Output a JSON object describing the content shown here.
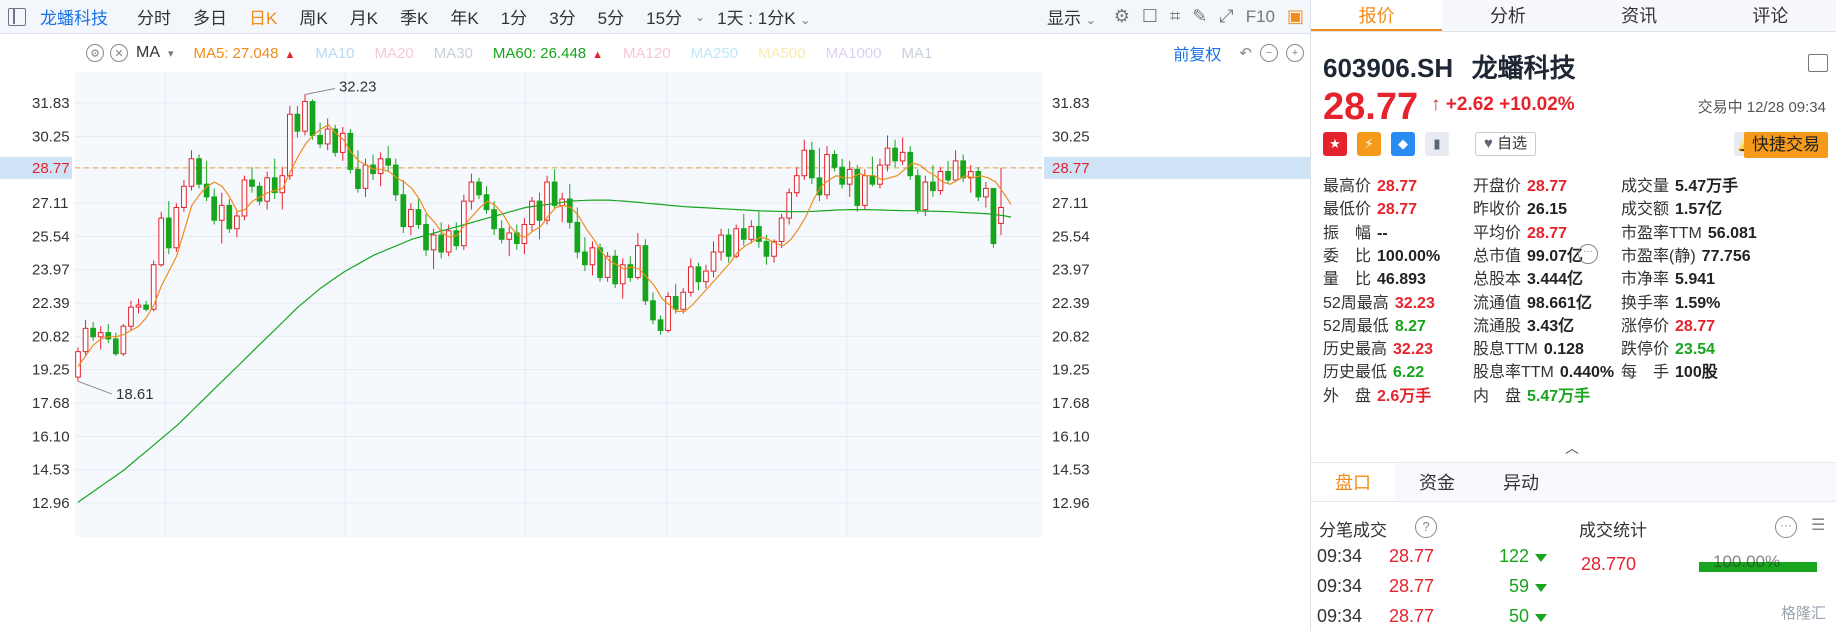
{
  "toolbar": {
    "stock_name": "龙蟠科技",
    "timeframes": [
      "分时",
      "多日",
      "日K",
      "周K",
      "月K",
      "季K",
      "年K",
      "1分",
      "3分",
      "5分",
      "15分"
    ],
    "active_timeframe": "日K",
    "period_select": "1天 : 1分K",
    "display_label": "显示"
  },
  "ma_row": {
    "indicator": "MA",
    "items": [
      {
        "label": "MA5:",
        "value": "27.048",
        "color": "#f08c1a",
        "up": true
      },
      {
        "label": "MA10",
        "value": "",
        "color": "#b8d8f5",
        "up": false
      },
      {
        "label": "MA20",
        "value": "",
        "color": "#f5c8d5",
        "up": false
      },
      {
        "label": "MA30",
        "value": "",
        "color": "#c8d0dc",
        "up": false
      },
      {
        "label": "MA60:",
        "value": "26.448",
        "color": "#16a51c",
        "up": true
      },
      {
        "label": "MA120",
        "value": "",
        "color": "#f5c8d5",
        "up": false
      },
      {
        "label": "MA250",
        "value": "",
        "color": "#bde8f5",
        "up": false
      },
      {
        "label": "MA500",
        "value": "",
        "color": "#f5eab5",
        "up": false
      },
      {
        "label": "MA1000",
        "value": "",
        "color": "#dcd0f0",
        "up": false
      },
      {
        "label": "MA1",
        "value": "",
        "color": "#c8d0dc",
        "up": false
      }
    ],
    "restore_label": "前复权"
  },
  "chart_data": {
    "type": "candlestick",
    "y_ticks": [
      "31.83",
      "30.25",
      "28.77",
      "27.11",
      "25.54",
      "23.97",
      "22.39",
      "20.82",
      "19.25",
      "17.68",
      "16.10",
      "14.53",
      "12.96"
    ],
    "current_price": 28.77,
    "current_price_label": "28.77",
    "high_label": "32.23",
    "low_label": "18.61",
    "ylim": [
      12.0,
      33.0
    ],
    "candles": [
      {
        "o": 18.9,
        "h": 20.3,
        "l": 18.7,
        "c": 20.1
      },
      {
        "o": 20.1,
        "h": 21.6,
        "l": 19.9,
        "c": 21.2
      },
      {
        "o": 21.2,
        "h": 21.5,
        "l": 20.6,
        "c": 20.8
      },
      {
        "o": 20.8,
        "h": 21.3,
        "l": 20.2,
        "c": 21.0
      },
      {
        "o": 21.0,
        "h": 21.4,
        "l": 20.5,
        "c": 20.7
      },
      {
        "o": 20.7,
        "h": 21.0,
        "l": 19.9,
        "c": 20.0
      },
      {
        "o": 20.0,
        "h": 21.4,
        "l": 19.9,
        "c": 21.3
      },
      {
        "o": 21.3,
        "h": 22.5,
        "l": 21.1,
        "c": 22.2
      },
      {
        "o": 22.2,
        "h": 22.6,
        "l": 21.9,
        "c": 22.3
      },
      {
        "o": 22.3,
        "h": 22.5,
        "l": 22.0,
        "c": 22.1
      },
      {
        "o": 22.1,
        "h": 24.4,
        "l": 22.0,
        "c": 24.2
      },
      {
        "o": 24.2,
        "h": 26.7,
        "l": 24.1,
        "c": 26.4
      },
      {
        "o": 26.4,
        "h": 27.2,
        "l": 24.7,
        "c": 25.0
      },
      {
        "o": 25.0,
        "h": 27.1,
        "l": 24.8,
        "c": 26.9
      },
      {
        "o": 26.9,
        "h": 28.2,
        "l": 26.7,
        "c": 27.9
      },
      {
        "o": 27.9,
        "h": 29.6,
        "l": 27.7,
        "c": 29.2
      },
      {
        "o": 29.2,
        "h": 29.4,
        "l": 27.8,
        "c": 28.0
      },
      {
        "o": 28.0,
        "h": 29.1,
        "l": 27.2,
        "c": 27.4
      },
      {
        "o": 27.4,
        "h": 27.8,
        "l": 26.1,
        "c": 26.3
      },
      {
        "o": 26.3,
        "h": 27.6,
        "l": 25.2,
        "c": 27.0
      },
      {
        "o": 27.0,
        "h": 27.3,
        "l": 25.7,
        "c": 25.9
      },
      {
        "o": 25.9,
        "h": 26.7,
        "l": 25.5,
        "c": 26.5
      },
      {
        "o": 26.5,
        "h": 28.4,
        "l": 26.3,
        "c": 28.2
      },
      {
        "o": 28.2,
        "h": 28.8,
        "l": 27.6,
        "c": 27.9
      },
      {
        "o": 27.9,
        "h": 28.1,
        "l": 27.0,
        "c": 27.2
      },
      {
        "o": 27.2,
        "h": 28.6,
        "l": 26.8,
        "c": 28.3
      },
      {
        "o": 28.3,
        "h": 29.2,
        "l": 27.3,
        "c": 27.6
      },
      {
        "o": 27.6,
        "h": 28.8,
        "l": 26.8,
        "c": 28.4
      },
      {
        "o": 28.4,
        "h": 31.7,
        "l": 28.2,
        "c": 31.3
      },
      {
        "o": 31.3,
        "h": 31.7,
        "l": 30.2,
        "c": 30.5
      },
      {
        "o": 30.5,
        "h": 32.23,
        "l": 30.3,
        "c": 31.9
      },
      {
        "o": 31.9,
        "h": 32.0,
        "l": 30.1,
        "c": 30.3
      },
      {
        "o": 30.3,
        "h": 30.9,
        "l": 29.7,
        "c": 29.9
      },
      {
        "o": 29.9,
        "h": 31.1,
        "l": 29.6,
        "c": 30.6
      },
      {
        "o": 30.6,
        "h": 30.8,
        "l": 29.3,
        "c": 29.5
      },
      {
        "o": 29.5,
        "h": 30.7,
        "l": 29.1,
        "c": 30.4
      },
      {
        "o": 30.4,
        "h": 30.6,
        "l": 28.5,
        "c": 28.7
      },
      {
        "o": 28.7,
        "h": 29.6,
        "l": 27.6,
        "c": 27.8
      },
      {
        "o": 27.8,
        "h": 29.2,
        "l": 27.4,
        "c": 28.9
      },
      {
        "o": 28.9,
        "h": 29.4,
        "l": 28.2,
        "c": 28.5
      },
      {
        "o": 28.5,
        "h": 29.5,
        "l": 27.9,
        "c": 29.2
      },
      {
        "o": 29.2,
        "h": 29.8,
        "l": 28.6,
        "c": 28.9
      },
      {
        "o": 28.9,
        "h": 29.2,
        "l": 27.2,
        "c": 27.5
      },
      {
        "o": 27.5,
        "h": 28.2,
        "l": 25.7,
        "c": 26.0
      },
      {
        "o": 26.0,
        "h": 27.1,
        "l": 25.6,
        "c": 26.8
      },
      {
        "o": 26.8,
        "h": 27.3,
        "l": 25.9,
        "c": 26.1
      },
      {
        "o": 26.1,
        "h": 26.6,
        "l": 24.6,
        "c": 24.9
      },
      {
        "o": 24.9,
        "h": 25.9,
        "l": 24.0,
        "c": 25.6
      },
      {
        "o": 25.6,
        "h": 26.2,
        "l": 24.5,
        "c": 24.8
      },
      {
        "o": 24.8,
        "h": 26.1,
        "l": 24.6,
        "c": 25.8
      },
      {
        "o": 25.8,
        "h": 26.2,
        "l": 24.9,
        "c": 25.1
      },
      {
        "o": 25.1,
        "h": 27.5,
        "l": 24.9,
        "c": 27.2
      },
      {
        "o": 27.2,
        "h": 28.5,
        "l": 26.8,
        "c": 28.1
      },
      {
        "o": 28.1,
        "h": 28.3,
        "l": 27.3,
        "c": 27.5
      },
      {
        "o": 27.5,
        "h": 27.9,
        "l": 26.6,
        "c": 26.8
      },
      {
        "o": 26.8,
        "h": 27.2,
        "l": 25.6,
        "c": 25.9
      },
      {
        "o": 25.9,
        "h": 26.3,
        "l": 25.2,
        "c": 25.4
      },
      {
        "o": 25.4,
        "h": 26.0,
        "l": 24.6,
        "c": 25.7
      },
      {
        "o": 25.7,
        "h": 26.1,
        "l": 24.9,
        "c": 25.2
      },
      {
        "o": 25.2,
        "h": 26.4,
        "l": 24.7,
        "c": 26.1
      },
      {
        "o": 26.1,
        "h": 27.4,
        "l": 25.8,
        "c": 27.2
      },
      {
        "o": 27.2,
        "h": 27.6,
        "l": 25.4,
        "c": 26.3
      },
      {
        "o": 26.3,
        "h": 28.4,
        "l": 26.1,
        "c": 28.1
      },
      {
        "o": 28.1,
        "h": 28.7,
        "l": 26.8,
        "c": 27.0
      },
      {
        "o": 27.0,
        "h": 27.6,
        "l": 26.2,
        "c": 27.3
      },
      {
        "o": 27.3,
        "h": 28.0,
        "l": 25.9,
        "c": 26.2
      },
      {
        "o": 26.2,
        "h": 26.9,
        "l": 24.5,
        "c": 24.8
      },
      {
        "o": 24.8,
        "h": 25.5,
        "l": 23.9,
        "c": 24.2
      },
      {
        "o": 24.2,
        "h": 25.3,
        "l": 23.7,
        "c": 25.0
      },
      {
        "o": 25.0,
        "h": 25.2,
        "l": 23.4,
        "c": 23.6
      },
      {
        "o": 23.6,
        "h": 24.8,
        "l": 23.4,
        "c": 24.6
      },
      {
        "o": 24.6,
        "h": 24.9,
        "l": 23.1,
        "c": 23.3
      },
      {
        "o": 23.3,
        "h": 24.5,
        "l": 22.6,
        "c": 24.2
      },
      {
        "o": 24.2,
        "h": 24.6,
        "l": 23.4,
        "c": 23.6
      },
      {
        "o": 23.6,
        "h": 25.7,
        "l": 23.5,
        "c": 25.1
      },
      {
        "o": 25.1,
        "h": 25.4,
        "l": 22.3,
        "c": 22.5
      },
      {
        "o": 22.5,
        "h": 22.9,
        "l": 21.4,
        "c": 21.6
      },
      {
        "o": 21.6,
        "h": 21.8,
        "l": 20.9,
        "c": 21.1
      },
      {
        "o": 21.1,
        "h": 22.9,
        "l": 21.0,
        "c": 22.7
      },
      {
        "o": 22.7,
        "h": 23.3,
        "l": 21.9,
        "c": 22.1
      },
      {
        "o": 22.1,
        "h": 23.1,
        "l": 21.9,
        "c": 22.9
      },
      {
        "o": 22.9,
        "h": 24.5,
        "l": 22.7,
        "c": 24.1
      },
      {
        "o": 24.1,
        "h": 24.3,
        "l": 23.0,
        "c": 23.4
      },
      {
        "o": 23.4,
        "h": 24.2,
        "l": 23.1,
        "c": 23.9
      },
      {
        "o": 23.9,
        "h": 25.3,
        "l": 23.6,
        "c": 24.8
      },
      {
        "o": 24.8,
        "h": 25.9,
        "l": 24.4,
        "c": 25.6
      },
      {
        "o": 25.6,
        "h": 25.9,
        "l": 24.3,
        "c": 24.6
      },
      {
        "o": 24.6,
        "h": 26.1,
        "l": 24.5,
        "c": 25.9
      },
      {
        "o": 25.9,
        "h": 26.6,
        "l": 25.1,
        "c": 25.4
      },
      {
        "o": 25.4,
        "h": 26.3,
        "l": 25.2,
        "c": 26.0
      },
      {
        "o": 26.0,
        "h": 26.7,
        "l": 25.0,
        "c": 25.3
      },
      {
        "o": 25.3,
        "h": 25.6,
        "l": 24.2,
        "c": 24.6
      },
      {
        "o": 24.6,
        "h": 25.4,
        "l": 24.3,
        "c": 25.3
      },
      {
        "o": 25.3,
        "h": 26.6,
        "l": 25.0,
        "c": 26.4
      },
      {
        "o": 26.4,
        "h": 27.8,
        "l": 26.1,
        "c": 27.6
      },
      {
        "o": 27.6,
        "h": 28.8,
        "l": 27.4,
        "c": 28.4
      },
      {
        "o": 28.4,
        "h": 30.1,
        "l": 28.2,
        "c": 29.6
      },
      {
        "o": 29.6,
        "h": 30.0,
        "l": 28.0,
        "c": 28.3
      },
      {
        "o": 28.3,
        "h": 29.7,
        "l": 27.2,
        "c": 27.5
      },
      {
        "o": 27.5,
        "h": 29.8,
        "l": 27.3,
        "c": 29.4
      },
      {
        "o": 29.4,
        "h": 29.6,
        "l": 28.6,
        "c": 28.8
      },
      {
        "o": 28.8,
        "h": 29.2,
        "l": 27.8,
        "c": 28.0
      },
      {
        "o": 28.0,
        "h": 29.1,
        "l": 27.4,
        "c": 28.7
      },
      {
        "o": 28.7,
        "h": 28.9,
        "l": 26.7,
        "c": 27.0
      },
      {
        "o": 27.0,
        "h": 28.7,
        "l": 26.8,
        "c": 28.4
      },
      {
        "o": 28.4,
        "h": 29.3,
        "l": 27.9,
        "c": 28.0
      },
      {
        "o": 28.0,
        "h": 29.2,
        "l": 27.8,
        "c": 28.9
      },
      {
        "o": 28.9,
        "h": 30.3,
        "l": 28.6,
        "c": 29.7
      },
      {
        "o": 29.7,
        "h": 30.1,
        "l": 28.8,
        "c": 29.1
      },
      {
        "o": 29.1,
        "h": 30.2,
        "l": 28.9,
        "c": 29.5
      },
      {
        "o": 29.5,
        "h": 29.8,
        "l": 28.2,
        "c": 28.4
      },
      {
        "o": 28.4,
        "h": 28.7,
        "l": 26.6,
        "c": 26.8
      },
      {
        "o": 26.8,
        "h": 28.4,
        "l": 26.5,
        "c": 28.1
      },
      {
        "o": 28.1,
        "h": 28.9,
        "l": 27.4,
        "c": 27.7
      },
      {
        "o": 27.7,
        "h": 28.8,
        "l": 27.5,
        "c": 28.6
      },
      {
        "o": 28.6,
        "h": 29.1,
        "l": 28.0,
        "c": 28.2
      },
      {
        "o": 28.2,
        "h": 29.6,
        "l": 28.1,
        "c": 29.1
      },
      {
        "o": 29.1,
        "h": 29.4,
        "l": 28.1,
        "c": 28.3
      },
      {
        "o": 28.3,
        "h": 28.9,
        "l": 27.6,
        "c": 28.6
      },
      {
        "o": 28.6,
        "h": 28.8,
        "l": 27.2,
        "c": 27.4
      },
      {
        "o": 27.4,
        "h": 28.1,
        "l": 26.9,
        "c": 27.8
      },
      {
        "o": 27.8,
        "h": 27.8,
        "l": 25.0,
        "c": 25.2
      },
      {
        "o": 26.15,
        "h": 28.77,
        "l": 25.6,
        "c": 26.9
      }
    ],
    "ma5": [
      19.4,
      19.9,
      20.4,
      20.7,
      20.8,
      20.8,
      20.9,
      21.1,
      21.3,
      21.7,
      22.3,
      23.2,
      23.9,
      24.6,
      25.8,
      27.0,
      27.5,
      27.9,
      28.1,
      27.9,
      27.4,
      26.7,
      26.8,
      27.2,
      27.4,
      27.6,
      27.7,
      27.8,
      28.6,
      29.3,
      29.9,
      30.3,
      30.6,
      30.8,
      30.4,
      30.1,
      29.5,
      29.1,
      28.9,
      28.7,
      28.7,
      28.6,
      28.3,
      28.1,
      27.8,
      27.3,
      26.6,
      26.2,
      25.7,
      25.5,
      25.6,
      26.1,
      26.5,
      26.9,
      27.2,
      27.0,
      26.6,
      26.0,
      25.6,
      25.5,
      25.8,
      26.0,
      26.5,
      26.9,
      27.0,
      26.9,
      26.5,
      25.9,
      25.4,
      24.8,
      24.4,
      24.2,
      24.0,
      24.1,
      24.0,
      23.6,
      23.2,
      22.6,
      22.3,
      22.0,
      22.0,
      22.3,
      22.7,
      23.1,
      23.5,
      23.9,
      24.3,
      24.8,
      25.1,
      25.3,
      25.5,
      25.4,
      25.2,
      25.1,
      25.4,
      25.9,
      26.5,
      27.3,
      27.9,
      28.2,
      28.4,
      28.3,
      28.3,
      28.5,
      28.4,
      28.4,
      28.2,
      28.3,
      28.4,
      28.7,
      29.0,
      28.9,
      28.6,
      28.4,
      28.1,
      28.0,
      28.2,
      28.4,
      28.3,
      28.4,
      28.3,
      28.1,
      27.6,
      27.048
    ],
    "ma60": [
      13.0,
      13.25,
      13.5,
      13.75,
      14.0,
      14.25,
      14.5,
      14.8,
      15.1,
      15.4,
      15.7,
      16.0,
      16.3,
      16.6,
      16.95,
      17.3,
      17.65,
      18.0,
      18.35,
      18.7,
      19.05,
      19.4,
      19.75,
      20.1,
      20.45,
      20.8,
      21.15,
      21.5,
      21.85,
      22.2,
      22.5,
      22.8,
      23.1,
      23.35,
      23.6,
      23.85,
      24.05,
      24.25,
      24.45,
      24.65,
      24.8,
      24.95,
      25.1,
      25.25,
      25.4,
      25.5,
      25.6,
      25.7,
      25.8,
      25.9,
      26.0,
      26.1,
      26.2,
      26.3,
      26.4,
      26.5,
      26.6,
      26.7,
      26.8,
      26.9,
      26.95,
      27.0,
      27.05,
      27.1,
      27.15,
      27.2,
      27.22,
      27.24,
      27.25,
      27.25,
      27.25,
      27.22,
      27.2,
      27.17,
      27.14,
      27.1,
      27.07,
      27.04,
      27.0,
      26.97,
      26.94,
      26.92,
      26.9,
      26.88,
      26.86,
      26.84,
      26.82,
      26.8,
      26.78,
      26.76,
      26.74,
      26.73,
      26.72,
      26.71,
      26.7,
      26.7,
      26.7,
      26.72,
      26.74,
      26.76,
      26.78,
      26.79,
      26.8,
      26.8,
      26.8,
      26.79,
      26.78,
      26.77,
      26.76,
      26.75,
      26.75,
      26.74,
      26.73,
      26.72,
      26.71,
      26.7,
      26.68,
      26.66,
      26.64,
      26.62,
      26.6,
      26.56,
      26.52,
      26.448
    ]
  },
  "quote": {
    "code": "603906.SH",
    "name": "龙蟠科技",
    "price": "28.77",
    "change": "+2.62",
    "change_pct": "+10.02%",
    "trade_info": "交易中 12/28 09:34",
    "watchlist_label": "自选",
    "quick_trade_label": "快捷交易"
  },
  "right_tabs": [
    "报价",
    "分析",
    "资讯",
    "评论"
  ],
  "stats": [
    [
      {
        "k": "最高价",
        "v": "28.77",
        "c": "red"
      },
      {
        "k": "开盘价",
        "v": "28.77",
        "c": "red"
      },
      {
        "k": "成交量",
        "v": "5.47万手",
        "c": "dark"
      }
    ],
    [
      {
        "k": "最低价",
        "v": "28.77",
        "c": "red"
      },
      {
        "k": "昨收价",
        "v": "26.15",
        "c": "dark"
      },
      {
        "k": "成交额",
        "v": "1.57亿",
        "c": "dark"
      }
    ],
    [
      {
        "k": "振　幅",
        "v": "--",
        "c": "dark"
      },
      {
        "k": "平均价",
        "v": "28.77",
        "c": "red"
      },
      {
        "k": "市盈率TTM",
        "v": "56.081",
        "c": "dark"
      }
    ],
    [
      {
        "k": "委　比",
        "v": "100.00%",
        "c": "dark"
      },
      {
        "k": "总市值",
        "v": "99.07亿",
        "c": "dark"
      },
      {
        "k": "市盈率(静)",
        "v": "77.756",
        "c": "dark"
      }
    ],
    [
      {
        "k": "量　比",
        "v": "46.893",
        "c": "dark"
      },
      {
        "k": "总股本",
        "v": "3.444亿",
        "c": "dark"
      },
      {
        "k": "市净率",
        "v": "5.941",
        "c": "dark"
      }
    ],
    [
      {
        "k": "52周最高",
        "v": "32.23",
        "c": "red"
      },
      {
        "k": "流通值",
        "v": "98.661亿",
        "c": "dark"
      },
      {
        "k": "换手率",
        "v": "1.59%",
        "c": "dark"
      }
    ],
    [
      {
        "k": "52周最低",
        "v": "8.27",
        "c": "green"
      },
      {
        "k": "流通股",
        "v": "3.43亿",
        "c": "dark"
      },
      {
        "k": "涨停价",
        "v": "28.77",
        "c": "red"
      }
    ],
    [
      {
        "k": "历史最高",
        "v": "32.23",
        "c": "red"
      },
      {
        "k": "股息TTM",
        "v": "0.128",
        "c": "dark"
      },
      {
        "k": "跌停价",
        "v": "23.54",
        "c": "green"
      }
    ],
    [
      {
        "k": "历史最低",
        "v": "6.22",
        "c": "green"
      },
      {
        "k": "股息率TTM",
        "v": "0.440%",
        "c": "dark"
      },
      {
        "k": "每　手",
        "v": "100股",
        "c": "dark"
      }
    ],
    [
      {
        "k": "外　盘",
        "v": "2.6万手",
        "c": "red"
      },
      {
        "k": "内　盘",
        "v": "5.47万手",
        "c": "green"
      }
    ]
  ],
  "sub_tabs": [
    "盘口",
    "资金",
    "异动"
  ],
  "trades": {
    "title": "分笔成交",
    "stat_title": "成交统计",
    "rows": [
      {
        "time": "09:34",
        "price": "28.77",
        "vol": "122"
      },
      {
        "time": "09:34",
        "price": "28.77",
        "vol": "59"
      },
      {
        "time": "09:34",
        "price": "28.77",
        "vol": "50"
      }
    ],
    "stat_price": "28.770",
    "stat_pct": "100.00%"
  },
  "watermark": "格隆汇"
}
